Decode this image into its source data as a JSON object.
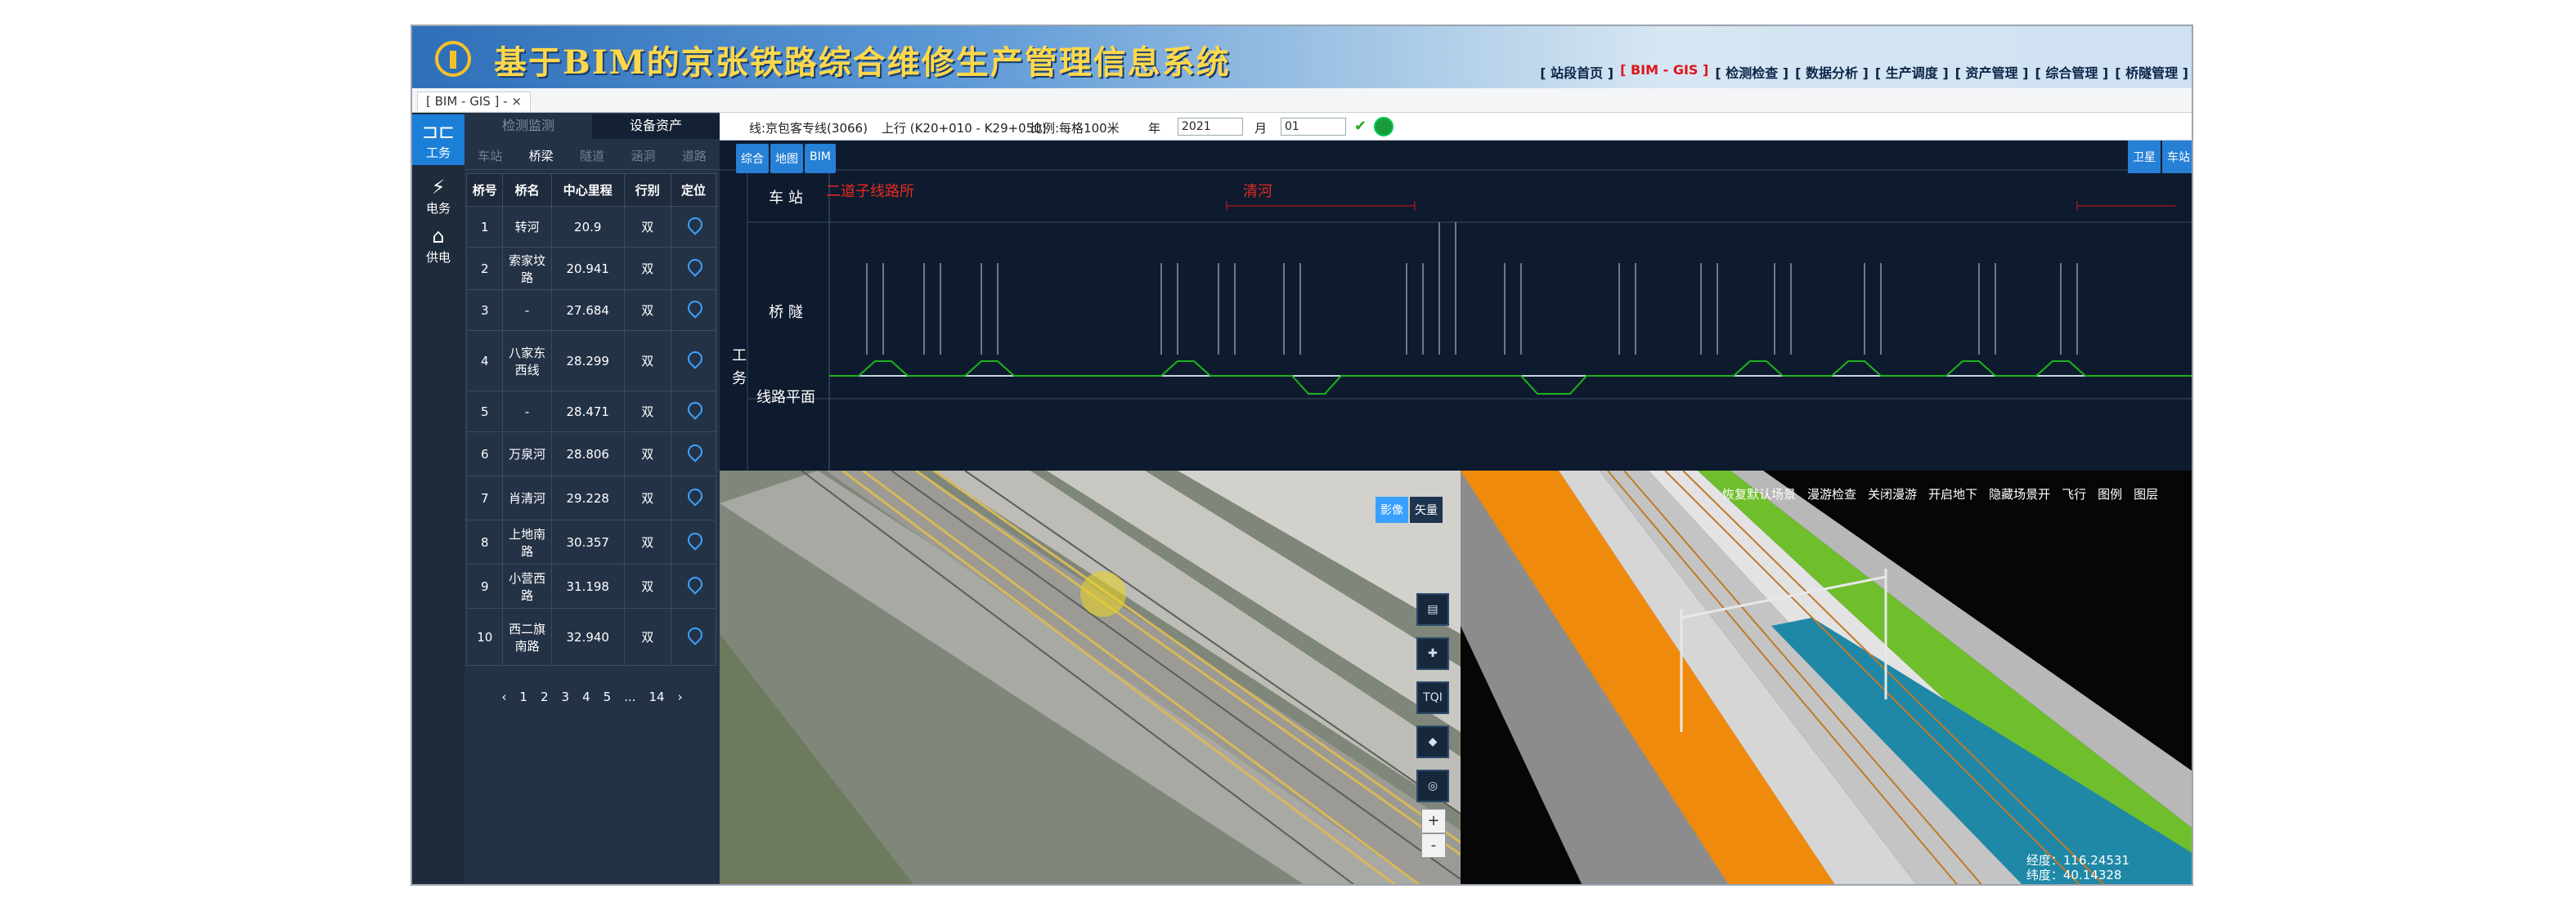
{
  "header": {
    "title": "基于BIM的京张铁路综合维修生产管理信息系统",
    "nav": [
      "[ 站段首页 ]",
      "[ BIM - GIS ]",
      "[ 检测检查 ]",
      "[ 数据分析 ]",
      "[ 生产调度 ]",
      "[ 资产管理 ]",
      "[ 综合管理 ]",
      "[ 桥隧管理 ]"
    ],
    "active_nav": "[ BIM - GIS ]"
  },
  "tab": {
    "label": "[ BIM - GIS ] - ×"
  },
  "rail": [
    {
      "label": "工务",
      "icon": "track-icon",
      "active": true
    },
    {
      "label": "电务",
      "icon": "lightning-icon",
      "active": false
    },
    {
      "label": "供电",
      "icon": "home-icon",
      "active": false
    }
  ],
  "sidepanel": {
    "tabs": [
      "检测监测",
      "设备资产"
    ],
    "active_tab": "设备资产",
    "subtabs": [
      "车站",
      "桥梁",
      "隧道",
      "涵洞",
      "道路"
    ],
    "active_subtab": "桥梁",
    "columns": [
      "桥号",
      "桥名",
      "中心里程",
      "行别",
      "定位"
    ],
    "rows": [
      {
        "no": "1",
        "name": "转河",
        "km": "20.9",
        "dir": "双"
      },
      {
        "no": "2",
        "name": "索家坟路",
        "km": "20.941",
        "dir": "双"
      },
      {
        "no": "3",
        "name": "-",
        "km": "27.684",
        "dir": "双"
      },
      {
        "no": "4",
        "name": "八家东西线",
        "km": "28.299",
        "dir": "双"
      },
      {
        "no": "5",
        "name": "-",
        "km": "28.471",
        "dir": "双"
      },
      {
        "no": "6",
        "name": "万泉河",
        "km": "28.806",
        "dir": "双"
      },
      {
        "no": "7",
        "name": "肖清河",
        "km": "29.228",
        "dir": "双"
      },
      {
        "no": "8",
        "name": "上地南路",
        "km": "30.357",
        "dir": "双"
      },
      {
        "no": "9",
        "name": "小营西路",
        "km": "31.198",
        "dir": "双"
      },
      {
        "no": "10",
        "name": "西二旗南路",
        "km": "32.940",
        "dir": "双"
      }
    ],
    "pager": [
      "‹",
      "1",
      "2",
      "3",
      "4",
      "5",
      "...",
      "14",
      "›"
    ]
  },
  "toolbar": {
    "line_label": "线:京包客专线(3066)",
    "range": "上行 (K20+010 - K29+050)",
    "scale": "比例:每格100米",
    "year_label": "年",
    "year": "2021",
    "month_label": "月",
    "month": "01"
  },
  "lineview": {
    "buttons": [
      "综合",
      "地图",
      "BIM"
    ],
    "right_buttons": [
      "卫星",
      "车站"
    ],
    "rows": [
      "车 站",
      "桥 隧",
      "线路平面"
    ],
    "section": "工务",
    "stations": [
      "二道子线路所",
      "清河"
    ]
  },
  "map": {
    "toggle": [
      "影像",
      "矢量"
    ],
    "tools": [
      "layers-icon",
      "puzzle-icon",
      "TQI",
      "cube-icon",
      "target-icon"
    ],
    "zoom": [
      "+",
      "-"
    ]
  },
  "bim3d": {
    "tools": [
      "恢复默认场景",
      "漫游检查",
      "关闭漫游",
      "开启地下",
      "隐藏场景开",
      "飞行",
      "图例",
      "图层"
    ],
    "coords": [
      "经度：116.24531",
      "纬度：40.14328"
    ]
  }
}
